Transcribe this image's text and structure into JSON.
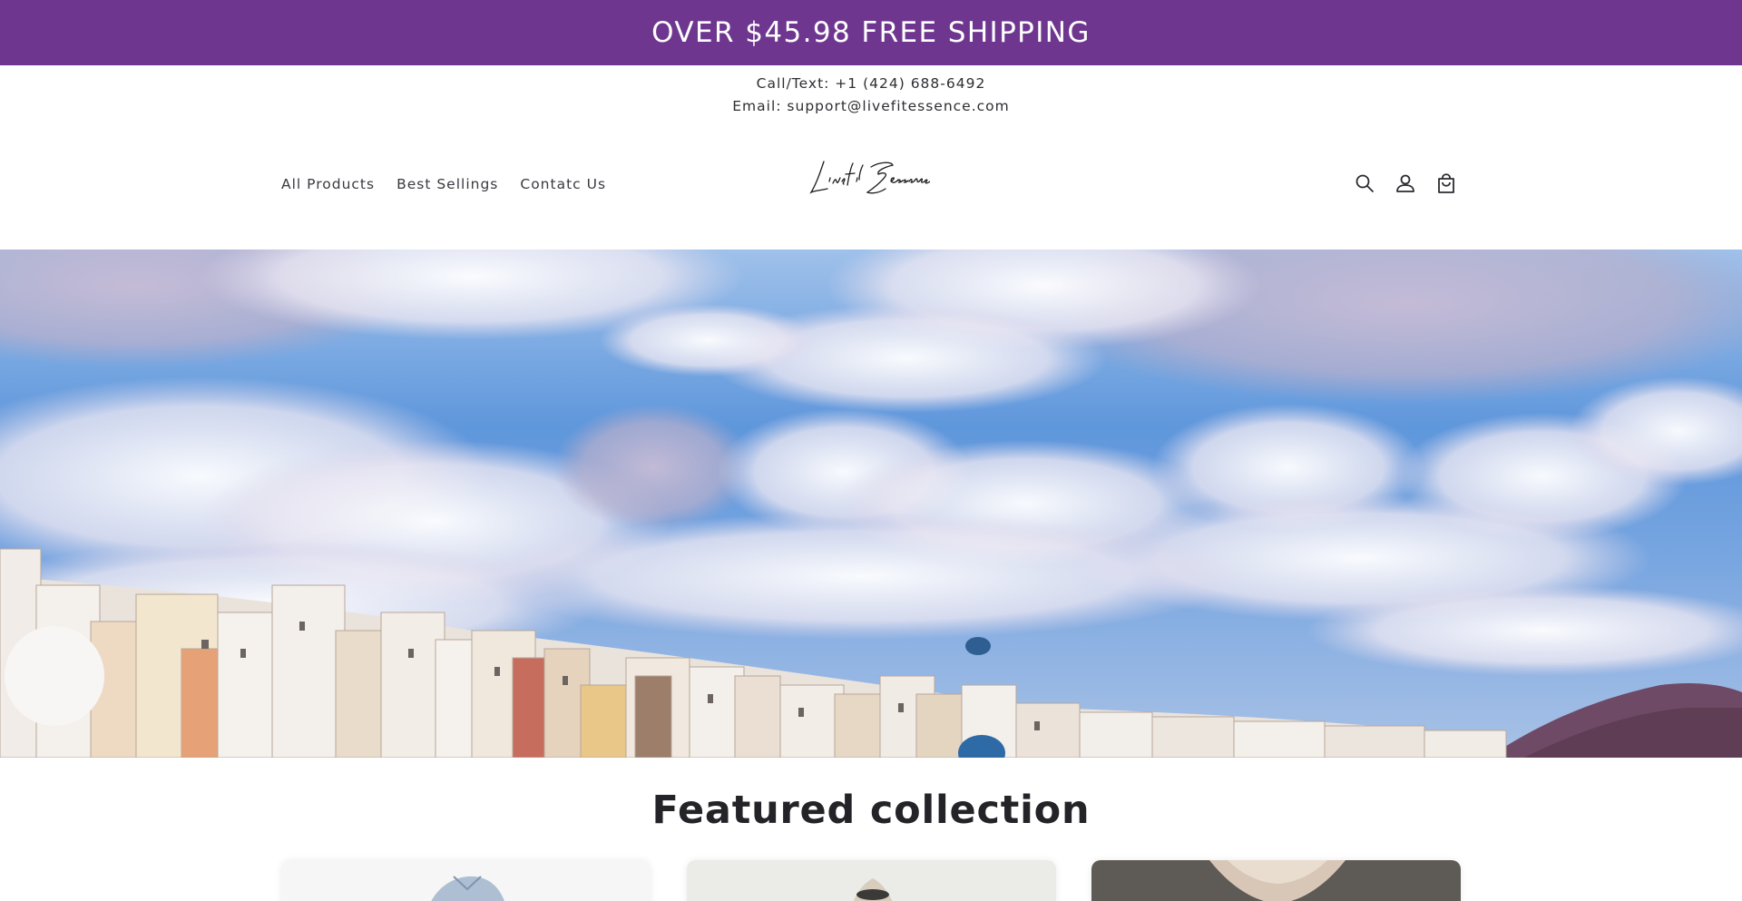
{
  "announcement": {
    "text": "OVER $45.98 FREE SHIPPING"
  },
  "contact": {
    "phone_line": "Call/Text: +1 (424) 688-6492",
    "email_line": "Email: support@livefitessence.com"
  },
  "nav": {
    "items": [
      {
        "label": "All Products"
      },
      {
        "label": "Best Sellings"
      },
      {
        "label": "Contatc Us"
      }
    ]
  },
  "logo": {
    "text": "Livefit Essence"
  },
  "header_icons": [
    "search-icon",
    "account-icon",
    "cart-icon"
  ],
  "featured": {
    "heading": "Featured collection"
  },
  "colors": {
    "announcement_bg": "#6e368f",
    "text": "#2b2b30"
  }
}
